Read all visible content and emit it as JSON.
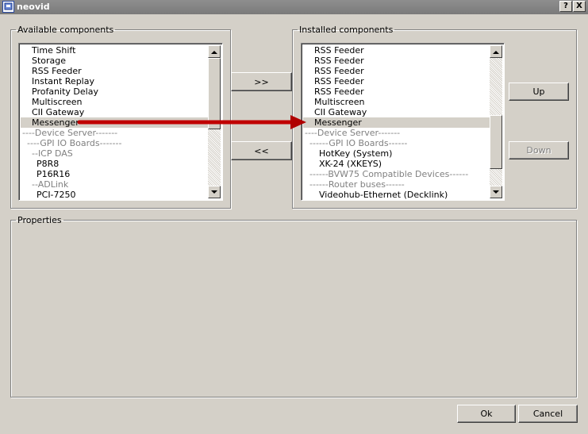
{
  "window": {
    "title": "neovid",
    "help_label": "?",
    "close_label": "X"
  },
  "available": {
    "legend": "Available components",
    "items": [
      {
        "label": "Time Shift",
        "indent": 14,
        "style": "normal"
      },
      {
        "label": "Storage",
        "indent": 14,
        "style": "normal"
      },
      {
        "label": "RSS Feeder",
        "indent": 14,
        "style": "normal"
      },
      {
        "label": "Instant Replay",
        "indent": 14,
        "style": "normal"
      },
      {
        "label": "Profanity Delay",
        "indent": 14,
        "style": "normal"
      },
      {
        "label": "Multiscreen",
        "indent": 14,
        "style": "normal"
      },
      {
        "label": "CII Gateway",
        "indent": 14,
        "style": "normal"
      },
      {
        "label": "Messenger",
        "indent": 14,
        "style": "selected"
      },
      {
        "label": "----Device Server-------",
        "indent": 2,
        "style": "gray"
      },
      {
        "label": "----GPI IO Boards-------",
        "indent": 8,
        "style": "gray"
      },
      {
        "label": "--ICP DAS",
        "indent": 14,
        "style": "gray"
      },
      {
        "label": "P8R8",
        "indent": 20,
        "style": "normal"
      },
      {
        "label": "P16R16",
        "indent": 20,
        "style": "normal"
      },
      {
        "label": "--ADLink",
        "indent": 14,
        "style": "gray"
      },
      {
        "label": "PCI-7250",
        "indent": 20,
        "style": "normal"
      }
    ]
  },
  "installed": {
    "legend": "Installed components",
    "items": [
      {
        "label": "RSS Feeder",
        "indent": 14,
        "style": "normal"
      },
      {
        "label": "RSS Feeder",
        "indent": 14,
        "style": "normal"
      },
      {
        "label": "RSS Feeder",
        "indent": 14,
        "style": "normal"
      },
      {
        "label": "RSS Feeder",
        "indent": 14,
        "style": "normal"
      },
      {
        "label": "RSS Feeder",
        "indent": 14,
        "style": "normal"
      },
      {
        "label": "Multiscreen",
        "indent": 14,
        "style": "normal"
      },
      {
        "label": "CII Gateway",
        "indent": 14,
        "style": "normal"
      },
      {
        "label": "Messenger",
        "indent": 14,
        "style": "selected"
      },
      {
        "label": "----Device Server-------",
        "indent": 2,
        "style": "gray"
      },
      {
        "label": "------GPI IO Boards------",
        "indent": 8,
        "style": "gray"
      },
      {
        "label": "HotKey (System)",
        "indent": 20,
        "style": "normal"
      },
      {
        "label": "XK-24 (XKEYS)",
        "indent": 20,
        "style": "normal"
      },
      {
        "label": "------BVW75 Compatible Devices------",
        "indent": 8,
        "style": "gray"
      },
      {
        "label": "------Router buses------",
        "indent": 8,
        "style": "gray"
      },
      {
        "label": "Videohub-Ethernet (Decklink)",
        "indent": 20,
        "style": "normal"
      }
    ]
  },
  "buttons": {
    "add_label": ">>",
    "remove_label": "<<",
    "up_label": "Up",
    "down_label": "Down",
    "ok_label": "Ok",
    "cancel_label": "Cancel"
  },
  "properties": {
    "legend": "Properties"
  },
  "colors": {
    "annotation_arrow": "#c00000",
    "window_face": "#d4d0c8",
    "titlebar": "#808080"
  }
}
